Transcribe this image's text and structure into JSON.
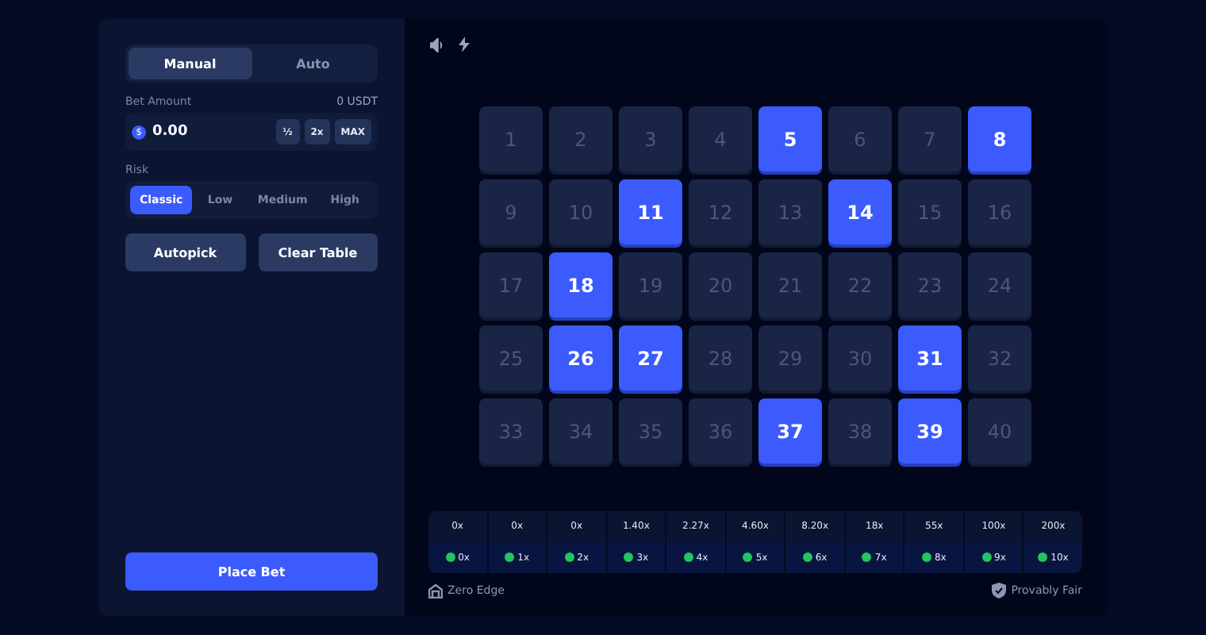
{
  "mode_tabs": [
    {
      "label": "Manual",
      "selected": true
    },
    {
      "label": "Auto",
      "selected": false
    }
  ],
  "bet": {
    "label": "Bet Amount",
    "balance": "0 USDT",
    "currency_symbol": "$",
    "value": "0.00",
    "buttons": [
      "½",
      "2x",
      "MAX"
    ]
  },
  "risk": {
    "label": "Risk",
    "options": [
      {
        "label": "Classic",
        "selected": true
      },
      {
        "label": "Low",
        "selected": false
      },
      {
        "label": "Medium",
        "selected": false
      },
      {
        "label": "High",
        "selected": false
      }
    ]
  },
  "actions": [
    "Autopick",
    "Clear Table"
  ],
  "place_bet": "Place Bet",
  "tiles": [
    {
      "n": "1",
      "selected": false
    },
    {
      "n": "2",
      "selected": false
    },
    {
      "n": "3",
      "selected": false
    },
    {
      "n": "4",
      "selected": false
    },
    {
      "n": "5",
      "selected": true
    },
    {
      "n": "6",
      "selected": false
    },
    {
      "n": "7",
      "selected": false
    },
    {
      "n": "8",
      "selected": true
    },
    {
      "n": "9",
      "selected": false
    },
    {
      "n": "10",
      "selected": false
    },
    {
      "n": "11",
      "selected": true
    },
    {
      "n": "12",
      "selected": false
    },
    {
      "n": "13",
      "selected": false
    },
    {
      "n": "14",
      "selected": true
    },
    {
      "n": "15",
      "selected": false
    },
    {
      "n": "16",
      "selected": false
    },
    {
      "n": "17",
      "selected": false
    },
    {
      "n": "18",
      "selected": true
    },
    {
      "n": "19",
      "selected": false
    },
    {
      "n": "20",
      "selected": false
    },
    {
      "n": "21",
      "selected": false
    },
    {
      "n": "22",
      "selected": false
    },
    {
      "n": "23",
      "selected": false
    },
    {
      "n": "24",
      "selected": false
    },
    {
      "n": "25",
      "selected": false
    },
    {
      "n": "26",
      "selected": true
    },
    {
      "n": "27",
      "selected": true
    },
    {
      "n": "28",
      "selected": false
    },
    {
      "n": "29",
      "selected": false
    },
    {
      "n": "30",
      "selected": false
    },
    {
      "n": "31",
      "selected": true
    },
    {
      "n": "32",
      "selected": false
    },
    {
      "n": "33",
      "selected": false
    },
    {
      "n": "34",
      "selected": false
    },
    {
      "n": "35",
      "selected": false
    },
    {
      "n": "36",
      "selected": false
    },
    {
      "n": "37",
      "selected": true
    },
    {
      "n": "38",
      "selected": false
    },
    {
      "n": "39",
      "selected": true
    },
    {
      "n": "40",
      "selected": false
    }
  ],
  "payouts": [
    {
      "multiplier": "0x",
      "hits": "0x",
      "color": "#22c55e"
    },
    {
      "multiplier": "0x",
      "hits": "1x",
      "color": "#22c55e"
    },
    {
      "multiplier": "0x",
      "hits": "2x",
      "color": "#22c55e"
    },
    {
      "multiplier": "1.40x",
      "hits": "3x",
      "color": "#22c55e"
    },
    {
      "multiplier": "2.27x",
      "hits": "4x",
      "color": "#22c55e"
    },
    {
      "multiplier": "4.60x",
      "hits": "5x",
      "color": "#22c55e"
    },
    {
      "multiplier": "8.20x",
      "hits": "6x",
      "color": "#22c55e"
    },
    {
      "multiplier": "18x",
      "hits": "7x",
      "color": "#22c55e"
    },
    {
      "multiplier": "55x",
      "hits": "8x",
      "color": "#22c55e"
    },
    {
      "multiplier": "100x",
      "hits": "9x",
      "color": "#22c55e"
    },
    {
      "multiplier": "200x",
      "hits": "10x",
      "color": "#22c55e"
    }
  ],
  "footer": {
    "left": "Zero Edge",
    "right": "Provably Fair"
  }
}
